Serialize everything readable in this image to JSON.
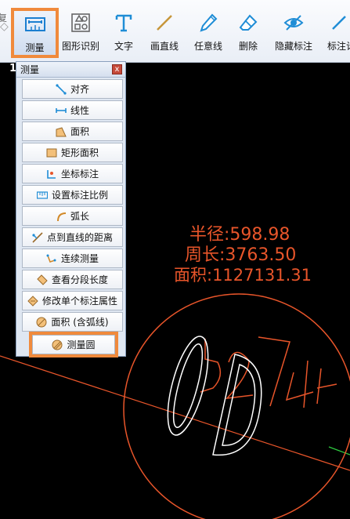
{
  "toolbar": {
    "partial_left_label": "复",
    "buttons": [
      {
        "id": "measure",
        "label": "测量",
        "icon": "ruler-icon"
      },
      {
        "id": "shape-recognition",
        "label": "图形识别",
        "icon": "shape-recognition-icon"
      },
      {
        "id": "text",
        "label": "文字",
        "icon": "text-t-icon"
      },
      {
        "id": "draw-line",
        "label": "画直线",
        "icon": "line-icon"
      },
      {
        "id": "freehand",
        "label": "任意线",
        "icon": "pen-icon"
      },
      {
        "id": "delete",
        "label": "删除",
        "icon": "eraser-icon"
      },
      {
        "id": "hide-annotation",
        "label": "隐藏标注",
        "icon": "eye-icon"
      },
      {
        "id": "annotate",
        "label": "标注计",
        "icon": "annotate-icon"
      }
    ],
    "stray_text": "1"
  },
  "panel": {
    "title": "测量",
    "close_label": "x",
    "items": [
      {
        "label": "对齐",
        "icon": "align-icon"
      },
      {
        "label": "线性",
        "icon": "linear-icon"
      },
      {
        "label": "面积",
        "icon": "area-icon"
      },
      {
        "label": "矩形面积",
        "icon": "rect-area-icon"
      },
      {
        "label": "坐标标注",
        "icon": "coordinate-icon"
      },
      {
        "label": "设置标注比例",
        "icon": "scale-icon"
      },
      {
        "label": "弧长",
        "icon": "arc-length-icon"
      },
      {
        "label": "点到直线的距离",
        "icon": "point-line-distance-icon"
      },
      {
        "label": "连续测量",
        "icon": "continuous-measure-icon"
      },
      {
        "label": "查看分段长度",
        "icon": "segment-length-icon"
      },
      {
        "label": "修改单个标注属性",
        "icon": "edit-annotation-icon"
      },
      {
        "label": "面积 (含弧线)",
        "icon": "area-arc-icon"
      },
      {
        "label": "测量圆",
        "icon": "measure-circle-icon"
      }
    ]
  },
  "canvas": {
    "radius_text": "半径:598.98",
    "perimeter_text": "周长:3763.50",
    "area_text": "面积:1127131.31",
    "sketch_text": "5274",
    "accent_color": "#f08a3c",
    "measure_color": "#e8552a"
  }
}
